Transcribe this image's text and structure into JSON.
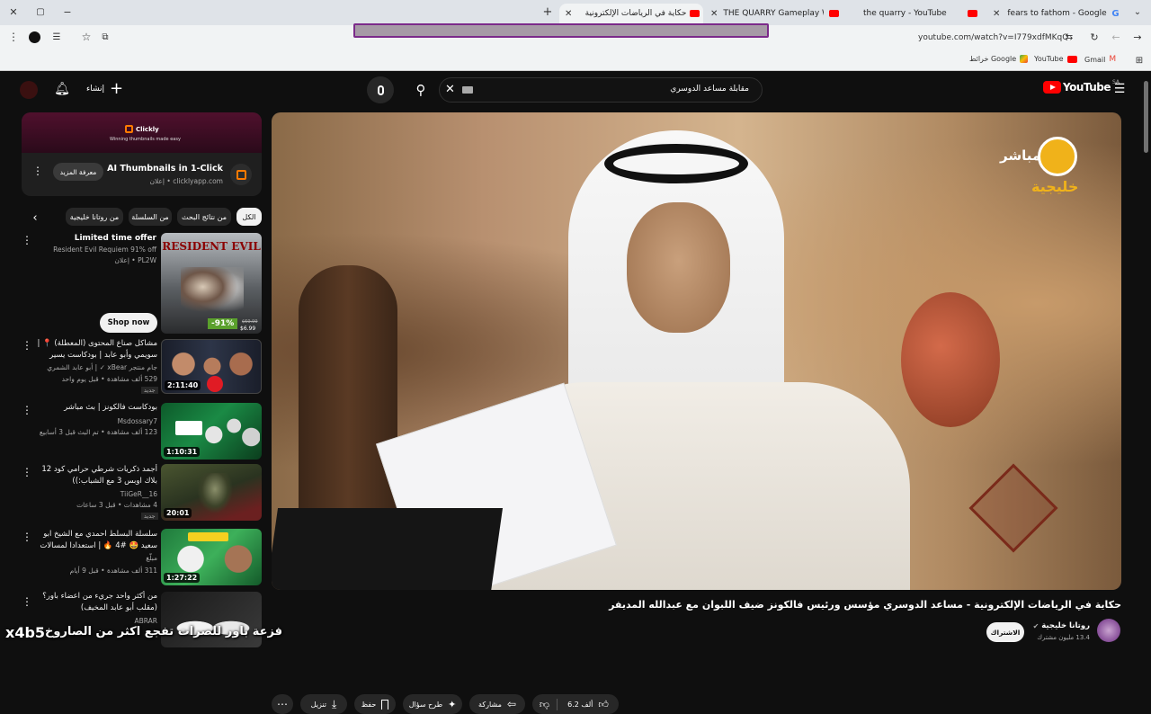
{
  "browser": {
    "tabs": [
      {
        "title": "حكاية في الرياضات الإلكترونية -",
        "active": true
      },
      {
        "title": "THE QUARRY Gameplay Walkth"
      },
      {
        "title": "the quarry - YouTube"
      },
      {
        "title": "fears to fathom - Google Searc"
      }
    ],
    "url": "youtube.com/watch?v=I779xdfMKqQ",
    "bookmarks": [
      "Gmail",
      "YouTube",
      "خرائط Google"
    ]
  },
  "youtube": {
    "logo": "YouTube",
    "region": "SA",
    "search_value": "مقابلة مساعد الدوسري",
    "create_label": "إنشاء",
    "ad": {
      "brand": "Clickly",
      "tagline": "Winning thumbnails made easy",
      "title": "AI Thumbnails in 1-Click",
      "sponsor": "إعلان • clicklyapp.com",
      "button": "معرفة المزيد"
    },
    "chips": [
      "الكل",
      "من نتائج البحث",
      "من السلسلة",
      "من روتانا خليجية"
    ],
    "promo": {
      "title": "Limited time offer",
      "desc": "Resident Evil Requiem 91% off",
      "sponsor": "إعلان • PL2W",
      "button": "Shop now",
      "game": "RESIDENT EVIL",
      "discount": "-91%",
      "old_price": "$69.99",
      "price": "$6.99"
    },
    "recs": [
      {
        "title": "مشاكل صناع المحتوى (المعطلة) 📍 | سويمي وأبو عابد | بودكاست يسير خير",
        "channel": "جام منتجر xBear ✓ | أبو عابد الشمري",
        "meta": "529 ألف مشاهدة • قبل يوم واحد",
        "badge": "جديد",
        "duration": "2:11:40"
      },
      {
        "title": "بودكاست فالكونز | بث مباشر",
        "channel": "Msdossary7",
        "meta": "123 ألف مشاهدة • تم البث قبل 3 أسابيع",
        "badge": "",
        "duration": "1:10:31"
      },
      {
        "title": "أجمد ذكريات شرطي حرامي كود 12 بلاك اوبس 3 مع الشباب:))",
        "channel": "TiiGeR__16",
        "meta": "4 مشاهدات • قبل 3 ساعات",
        "badge": "جديد",
        "duration": "20:01"
      },
      {
        "title": "سلسلة البسلط احمدي مع الشيخ ابو سعيد 🤩 #4 🔥 | استعدادا لمسالات المغامر...",
        "channel": "مبلّغ",
        "meta": "311 ألف مشاهدة • قبل 9 أيام",
        "badge": "",
        "duration": "1:27:22"
      },
      {
        "title": "من أكثر واحد جريء من اعضاء باور؟ (مقلب أبو عابد المخيف)",
        "channel": "ABRAR",
        "meta": "",
        "badge": "",
        "duration": ""
      }
    ],
    "video": {
      "title": "حكاية في الرياضات الإلكترونية - مساعد الدوسري مؤسس ورئيس فالكونز ضيف اللبوان مع عبدالله المديفر",
      "channel": "روتانا خليجية",
      "subs": "13.4 مليون مشترك",
      "subscribe": "الاشتراك",
      "likes": "6.2 ألف",
      "share": "مشاركة",
      "ask": "طرح سؤال",
      "save": "حفظ",
      "download": "تنزيل",
      "channel_logo": "خليجية",
      "live": "مباشر"
    },
    "overlay": {
      "watermark": "x4b5",
      "caption": "فزعة باور للصرات تفجع اكثر من الصاروخ"
    }
  }
}
